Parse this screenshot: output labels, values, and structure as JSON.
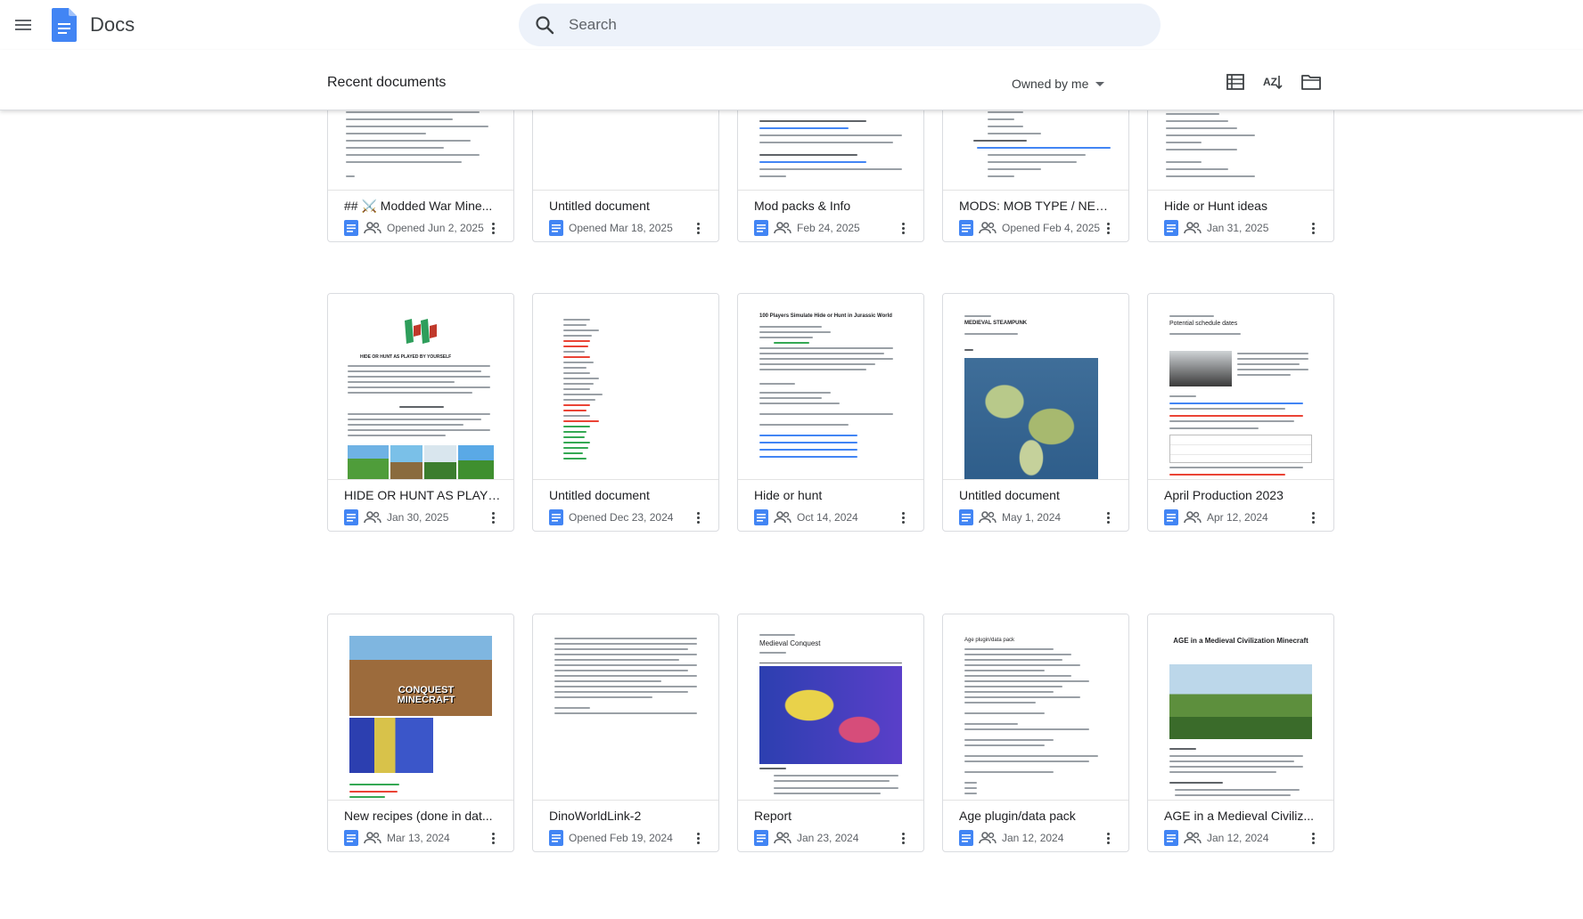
{
  "header": {
    "app_title": "Docs",
    "search_placeholder": "Search"
  },
  "toolbar": {
    "section_title": "Recent documents",
    "owner_filter": "Owned by me"
  },
  "icons": {
    "menu": "hamburger-menu-icon",
    "logo": "docs-logo-icon",
    "search": "search-icon",
    "list_view": "list-view-icon",
    "sort": "sort-az-icon",
    "folder": "folder-icon",
    "doc": "doc-file-icon",
    "shared": "shared-people-icon",
    "more": "more-vert-icon"
  },
  "colors": {
    "accent": "#4285f4",
    "search_bg": "#edf2fa",
    "border": "#dadce0"
  },
  "documents": [
    {
      "title": "## ⚔️ Modded War Mine...",
      "date": "Opened Jun 2, 2025",
      "thumb_text": ""
    },
    {
      "title": "Untitled document",
      "date": "Opened Mar 18, 2025",
      "thumb_text": ""
    },
    {
      "title": "Mod packs & Info",
      "date": "Feb 24, 2025",
      "thumb_text": ""
    },
    {
      "title": "MODS: MOB TYPE / NEW ...",
      "date": "Opened Feb 4, 2025",
      "thumb_text": ""
    },
    {
      "title": "Hide or Hunt ideas",
      "date": "Jan 31, 2025",
      "thumb_text": ""
    },
    {
      "title": "HIDE OR HUNT AS PLAYE...",
      "date": "Jan 30, 2025",
      "thumb_text": "HIDE OR HUNT AS PLAYED BY YOURSELF"
    },
    {
      "title": "Untitled document",
      "date": "Opened Dec 23, 2024",
      "thumb_text": ""
    },
    {
      "title": "Hide or hunt",
      "date": "Oct 14, 2024",
      "thumb_text": "100 Players Simulate Hide or Hunt in Jurassic World"
    },
    {
      "title": "Untitled document",
      "date": "May 1, 2024",
      "thumb_text": "MEDIEVAL STEAMPUNK"
    },
    {
      "title": "April Production 2023",
      "date": "Apr 12, 2024",
      "thumb_text": "Potential schedule dates"
    },
    {
      "title": "New recipes (done in dat...",
      "date": "Mar 13, 2024",
      "thumb_text": "CONQUEST MINECRAFT"
    },
    {
      "title": "DinoWorldLink-2",
      "date": "Opened Feb 19, 2024",
      "thumb_text": ""
    },
    {
      "title": "Report",
      "date": "Jan 23, 2024",
      "thumb_text": "Medieval Conquest"
    },
    {
      "title": "Age plugin/data pack",
      "date": "Jan 12, 2024",
      "thumb_text": "Age plugin/data pack"
    },
    {
      "title": "AGE in a Medieval Civiliz...",
      "date": "Jan 12, 2024",
      "thumb_text": "AGE in a Medieval Civilization Minecraft"
    }
  ]
}
